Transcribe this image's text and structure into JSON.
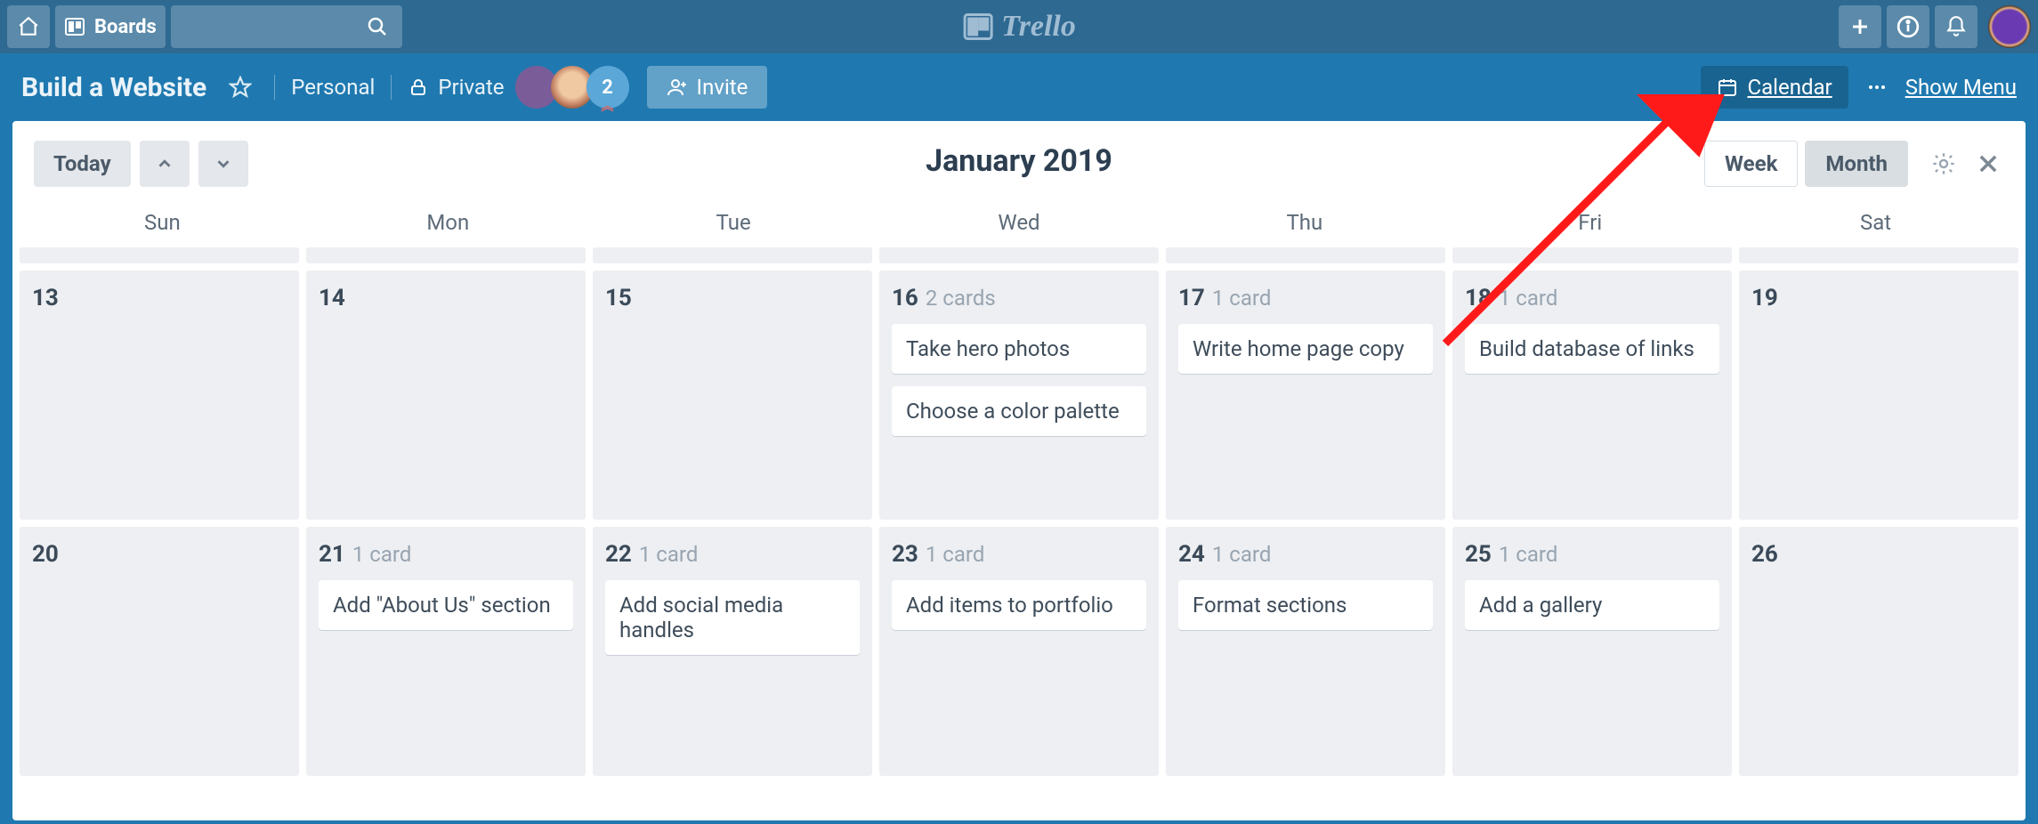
{
  "header": {
    "boards_label": "Boards",
    "logo_text": "Trello"
  },
  "board": {
    "title": "Build a Website",
    "team_label": "Personal",
    "visibility_label": "Private",
    "extra_member_count": "2",
    "invite_label": "Invite",
    "calendar_label": "Calendar",
    "show_menu_label": "Show Menu"
  },
  "calendar": {
    "today_label": "Today",
    "title": "January 2019",
    "view_week": "Week",
    "view_month": "Month",
    "active_view": "Month",
    "dow": [
      "Sun",
      "Mon",
      "Tue",
      "Wed",
      "Thu",
      "Fri",
      "Sat"
    ],
    "rows": [
      {
        "cells": [
          {
            "day": "13"
          },
          {
            "day": "14"
          },
          {
            "day": "15"
          },
          {
            "day": "16",
            "count": "2 cards",
            "cards": [
              "Take hero photos",
              "Choose a color palette"
            ]
          },
          {
            "day": "17",
            "count": "1 card",
            "cards": [
              "Write home page copy"
            ]
          },
          {
            "day": "18",
            "count": "1 card",
            "cards": [
              "Build database of links"
            ]
          },
          {
            "day": "19"
          }
        ]
      },
      {
        "cells": [
          {
            "day": "20"
          },
          {
            "day": "21",
            "count": "1 card",
            "cards": [
              "Add \"About Us\" section"
            ]
          },
          {
            "day": "22",
            "count": "1 card",
            "cards": [
              "Add social media handles"
            ]
          },
          {
            "day": "23",
            "count": "1 card",
            "cards": [
              "Add items to portfolio"
            ]
          },
          {
            "day": "24",
            "count": "1 card",
            "cards": [
              "Format sections"
            ]
          },
          {
            "day": "25",
            "count": "1 card",
            "cards": [
              "Add a gallery"
            ]
          },
          {
            "day": "26"
          }
        ]
      }
    ]
  }
}
